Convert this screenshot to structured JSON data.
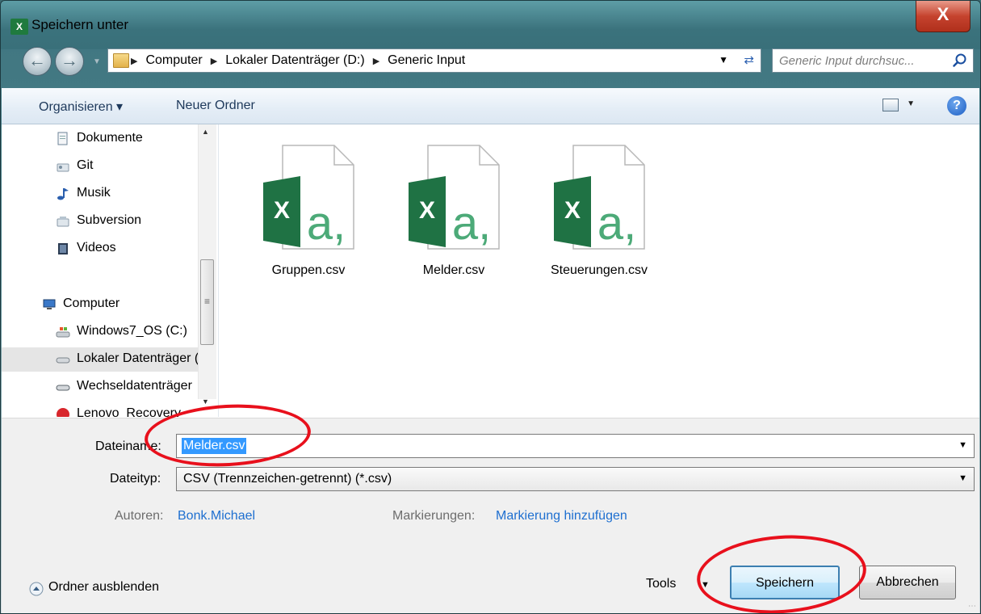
{
  "window": {
    "title": "Speichern unter",
    "app_icon": "excel-icon",
    "close_glyph": "X"
  },
  "navbar": {
    "breadcrumb": [
      "Computer",
      "Lokaler Datenträger (D:)",
      "Generic Input"
    ],
    "search_placeholder": "Generic Input durchsuc..."
  },
  "toolbar": {
    "organize_label": "Organisieren ▾",
    "new_folder_label": "Neuer Ordner",
    "help_glyph": "?"
  },
  "sidebar": {
    "items": [
      {
        "label": "Dokumente",
        "icon": "documents-icon"
      },
      {
        "label": "Git",
        "icon": "git-folder-icon"
      },
      {
        "label": "Musik",
        "icon": "music-icon"
      },
      {
        "label": "Subversion",
        "icon": "subversion-folder-icon"
      },
      {
        "label": "Videos",
        "icon": "videos-icon"
      },
      {
        "label": "Computer",
        "icon": "computer-icon"
      },
      {
        "label": "Windows7_OS (C:)",
        "icon": "windows-drive-icon"
      },
      {
        "label": "Lokaler Datenträger (D:)",
        "icon": "drive-icon",
        "selected": true
      },
      {
        "label": "Wechseldatenträger",
        "icon": "removable-drive-icon"
      },
      {
        "label": "Lenovo_Recovery",
        "icon": "recovery-drive-icon"
      }
    ]
  },
  "files": [
    {
      "name": "Gruppen.csv",
      "icon": "excel-csv-file-icon"
    },
    {
      "name": "Melder.csv",
      "icon": "excel-csv-file-icon"
    },
    {
      "name": "Steuerungen.csv",
      "icon": "excel-csv-file-icon"
    }
  ],
  "form": {
    "filename_label": "Dateiname:",
    "filename_value": "Melder.csv",
    "filetype_label": "Dateityp:",
    "filetype_value": "CSV (Trennzeichen-getrennt) (*.csv)",
    "authors_label": "Autoren:",
    "authors_value": "Bonk.Michael",
    "tags_label": "Markierungen:",
    "tags_value": "Markierung hinzufügen"
  },
  "footer": {
    "hide_folders_label": "Ordner ausblenden",
    "tools_label": "Tools",
    "save_label": "Speichern",
    "cancel_label": "Abbrechen"
  },
  "colors": {
    "accent": "#3399ff",
    "link": "#1e6fd0",
    "excel_green": "#1f7244",
    "annotation_red": "#e8101c"
  }
}
